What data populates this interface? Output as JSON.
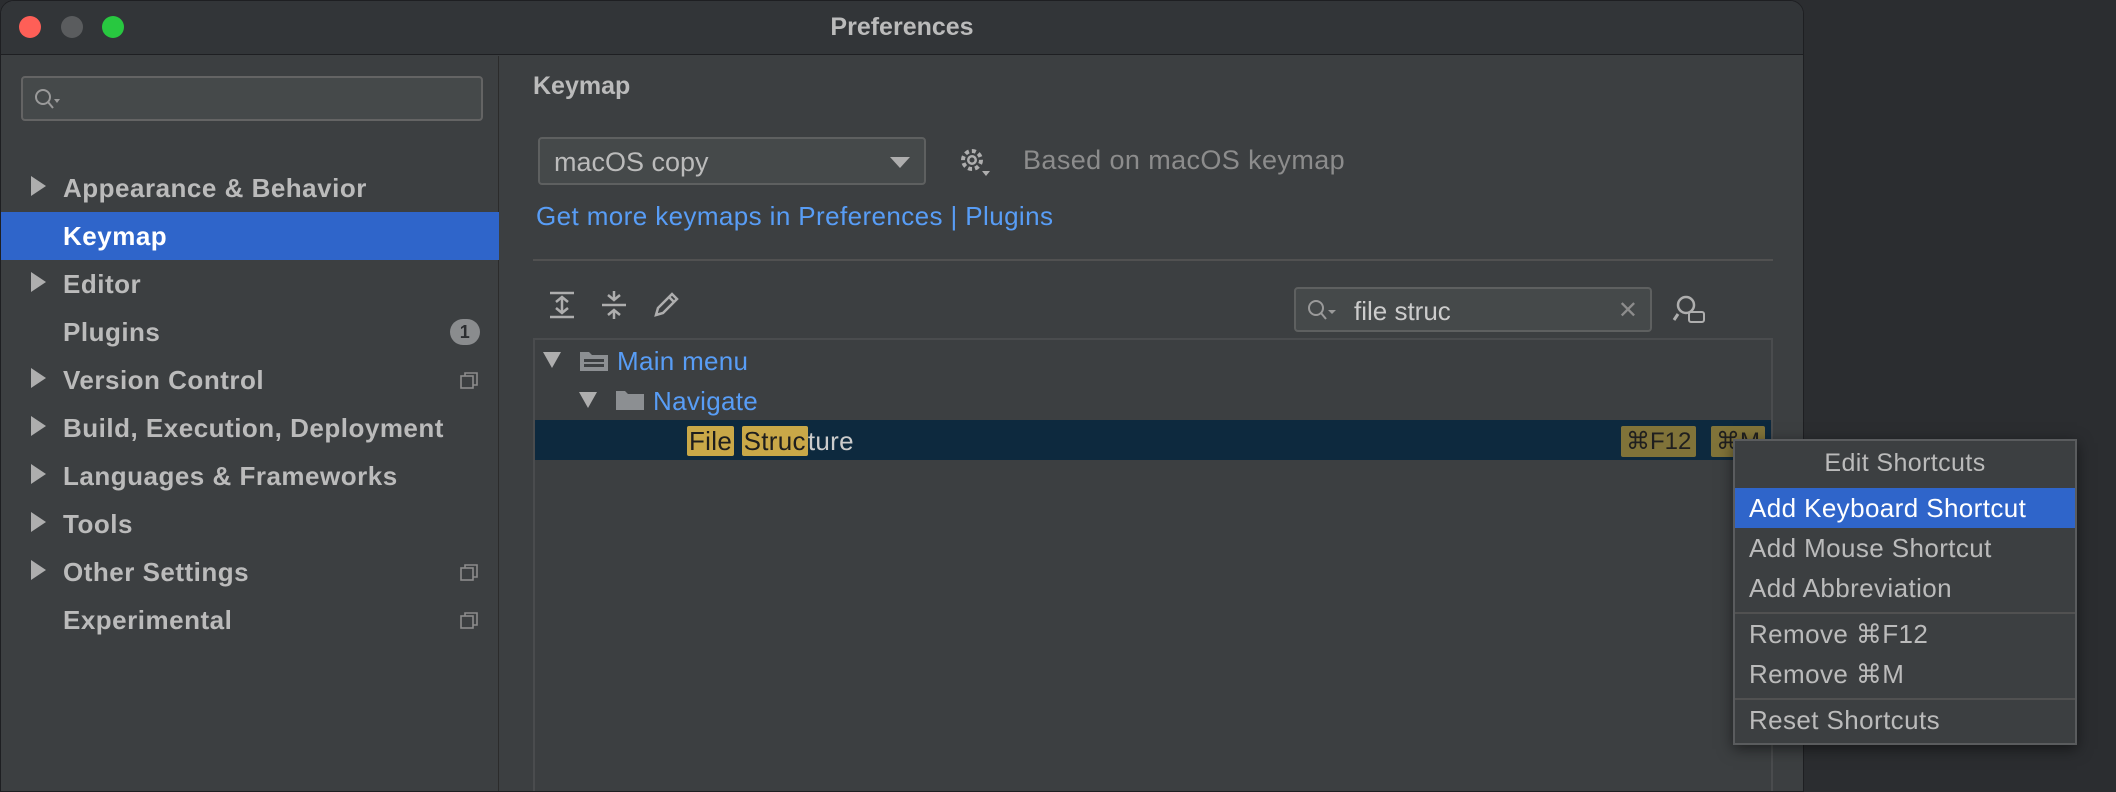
{
  "window": {
    "title": "Preferences"
  },
  "sidebar": {
    "search_placeholder": "",
    "items": [
      {
        "label": "Appearance & Behavior",
        "expandable": true
      },
      {
        "label": "Keymap",
        "selected": true
      },
      {
        "label": "Editor",
        "expandable": true
      },
      {
        "label": "Plugins",
        "badge": "1"
      },
      {
        "label": "Version Control",
        "expandable": true
      },
      {
        "label": "Build, Execution, Deployment",
        "expandable": true
      },
      {
        "label": "Languages & Frameworks",
        "expandable": true
      },
      {
        "label": "Tools",
        "expandable": true
      },
      {
        "label": "Other Settings",
        "expandable": true
      },
      {
        "label": "Experimental"
      }
    ]
  },
  "main": {
    "heading": "Keymap",
    "keymap_select": "macOS copy",
    "based_on": "Based on macOS keymap",
    "link": "Get more keymaps in Preferences | Plugins",
    "filter": {
      "value": "file struc",
      "clear": "✕"
    },
    "tree": {
      "root": "Main menu",
      "child": "Navigate",
      "leaf": {
        "hl1": "File",
        "hl2": "Struc",
        "rest": "ture",
        "shortcut1": "⌘F12",
        "shortcut2": "⌘M"
      }
    }
  },
  "context_menu": {
    "title": "Edit Shortcuts",
    "items": [
      "Add Keyboard Shortcut",
      "Add Mouse Shortcut",
      "Add Abbreviation",
      "Remove ⌘F12",
      "Remove ⌘M",
      "Reset Shortcuts"
    ]
  },
  "colors": {
    "accent": "#2f65ca",
    "link": "#589df6",
    "highlight": "#c9a848"
  }
}
